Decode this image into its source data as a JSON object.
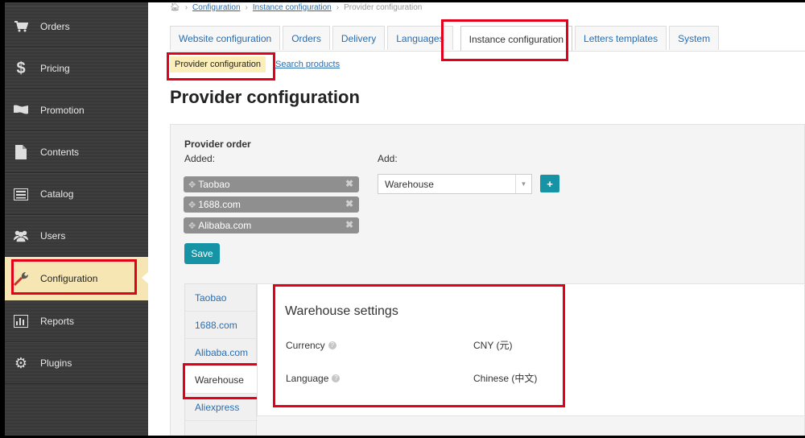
{
  "breadcrumb": {
    "items": [
      "Configuration",
      "Instance configuration",
      "Provider configuration"
    ]
  },
  "sidebar": {
    "items": [
      {
        "label": "Orders",
        "icon": "cart-icon"
      },
      {
        "label": "Pricing",
        "icon": "dollar-icon"
      },
      {
        "label": "Promotion",
        "icon": "flag-icon"
      },
      {
        "label": "Contents",
        "icon": "document-icon"
      },
      {
        "label": "Catalog",
        "icon": "list-icon"
      },
      {
        "label": "Users",
        "icon": "users-icon"
      },
      {
        "label": "Configuration",
        "icon": "wrench-icon",
        "active": true
      },
      {
        "label": "Reports",
        "icon": "bar-chart-icon"
      },
      {
        "label": "Plugins",
        "icon": "gear-icon"
      }
    ]
  },
  "tabs": [
    {
      "label": "Website configuration"
    },
    {
      "label": "Orders"
    },
    {
      "label": "Delivery"
    },
    {
      "label": "Languages"
    },
    {
      "label": "Instance configuration",
      "active": true
    },
    {
      "label": "Letters templates"
    },
    {
      "label": "System"
    }
  ],
  "subnav": {
    "active": "Provider configuration",
    "link": "Search products"
  },
  "page": {
    "title": "Provider configuration"
  },
  "provider_order": {
    "heading": "Provider order",
    "added_label": "Added:",
    "add_label": "Add:",
    "added": [
      "Taobao",
      "1688.com",
      "Alibaba.com"
    ],
    "select_value": "Warehouse",
    "plus_label": "+",
    "save_label": "Save"
  },
  "providers": [
    "Taobao",
    "1688.com",
    "Alibaba.com",
    "Warehouse",
    "Aliexpress"
  ],
  "active_provider": "Warehouse",
  "settings": {
    "title": "Warehouse settings",
    "rows": [
      {
        "label": "Currency",
        "value": "CNY (元)"
      },
      {
        "label": "Language",
        "value": "Chinese (中文)"
      }
    ]
  },
  "colors": {
    "accent": "#1693a5",
    "highlight": "#e3001b",
    "active_bg": "#f6e6b4",
    "sidebar_bg": "#3a3a3a"
  }
}
